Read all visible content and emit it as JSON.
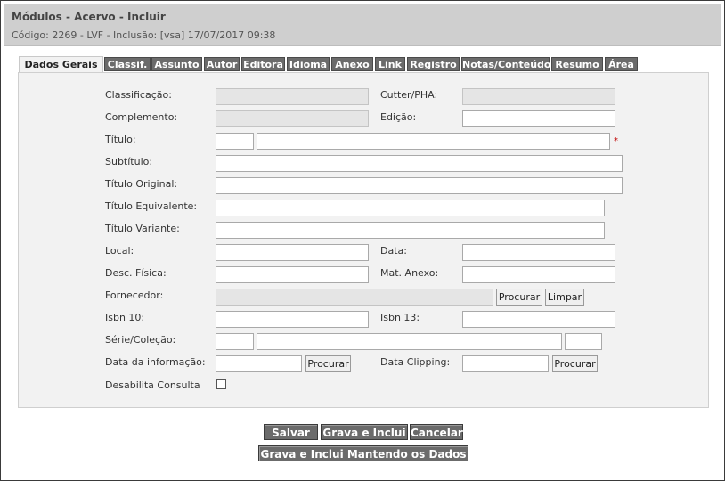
{
  "header": {
    "title": "Módulos - Acervo - Incluir",
    "subtitle": "Código: 2269 - LVF - Inclusão: [vsa] 17/07/2017 09:38"
  },
  "tabs": [
    {
      "label": "Dados Gerais"
    },
    {
      "label": "Classif."
    },
    {
      "label": "Assunto"
    },
    {
      "label": "Autor"
    },
    {
      "label": "Editora"
    },
    {
      "label": "Idioma"
    },
    {
      "label": "Anexo"
    },
    {
      "label": "Link"
    },
    {
      "label": "Registro"
    },
    {
      "label": "Notas/Conteúdo"
    },
    {
      "label": "Resumo"
    },
    {
      "label": "Área"
    }
  ],
  "form": {
    "classificacao": "Classificação:",
    "cutter": "Cutter/PHA:",
    "complemento": "Complemento:",
    "edicao": "Edição:",
    "titulo": "Título:",
    "required_mark": "*",
    "subtitulo": "Subtítulo:",
    "titulo_original": "Título Original:",
    "titulo_equivalente": "Título Equivalente:",
    "titulo_variante": "Título Variante:",
    "local": "Local:",
    "data": "Data:",
    "desc_fisica": "Desc. Física:",
    "mat_anexo": "Mat. Anexo:",
    "fornecedor": "Fornecedor:",
    "procurar": "Procurar",
    "limpar": "Limpar",
    "isbn10": "Isbn 10:",
    "isbn13": "Isbn 13:",
    "serie_colecao": "Série/Coleção:",
    "data_informacao": "Data da informação:",
    "data_clipping": "Data Clipping:",
    "desabilita_consulta": "Desabilita Consulta"
  },
  "actions": {
    "salvar": "Salvar",
    "grava_inclui": "Grava e Inclui",
    "cancelar": "Cancelar",
    "grava_inclui_mantendo": "Grava e Inclui Mantendo os Dados"
  }
}
